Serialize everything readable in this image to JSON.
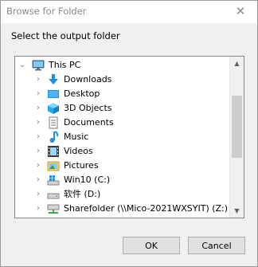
{
  "window": {
    "title": "Browse for Folder",
    "close_glyph": "✕"
  },
  "prompt": "Select the output folder",
  "tree": {
    "root": {
      "label": "This PC",
      "icon": "computer-icon",
      "expanded": true
    },
    "items": [
      {
        "label": "Downloads",
        "icon": "downloads-icon"
      },
      {
        "label": "Desktop",
        "icon": "desktop-icon"
      },
      {
        "label": "3D Objects",
        "icon": "3d-objects-icon"
      },
      {
        "label": "Documents",
        "icon": "documents-icon"
      },
      {
        "label": "Music",
        "icon": "music-icon"
      },
      {
        "label": "Videos",
        "icon": "videos-icon"
      },
      {
        "label": "Pictures",
        "icon": "pictures-icon"
      },
      {
        "label": "Win10 (C:)",
        "icon": "windows-drive-icon"
      },
      {
        "label": "软件 (D:)",
        "icon": "drive-icon"
      },
      {
        "label": "Sharefolder (\\\\Mico-2021WXSYIT) (Z:)",
        "icon": "network-drive-icon"
      }
    ],
    "scroll_position": 0.35
  },
  "buttons": {
    "ok": "OK",
    "cancel": "Cancel"
  },
  "colors": {
    "dialog_bg": "#f0f0f0",
    "accent_blue": "#1e8fe1",
    "folder_yellow": "#f6cd5a"
  }
}
